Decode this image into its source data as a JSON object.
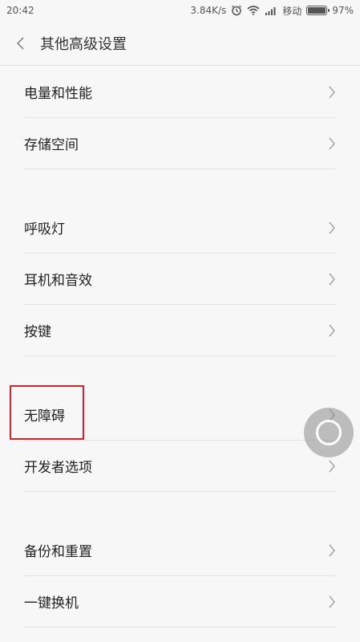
{
  "status_bar": {
    "time": "20:42",
    "speed": "3.84K/s",
    "carrier": "移动",
    "battery": "97%",
    "battery_level": 0.97,
    "icons": [
      "alarm-icon",
      "wifi-icon",
      "signal-icon",
      "battery-icon"
    ]
  },
  "header": {
    "title": "其他高级设置",
    "back_icon": "chevron-left-icon"
  },
  "groups": [
    {
      "items": [
        "电量和性能",
        "存储空间"
      ]
    },
    {
      "items": [
        "呼吸灯",
        "耳机和音效",
        "按键"
      ]
    },
    {
      "items": [
        "无障碍",
        "开发者选项"
      ]
    },
    {
      "items": [
        "备份和重置",
        "一键换机"
      ]
    }
  ],
  "highlight": {
    "item": "无障碍",
    "color": "#d9232d"
  },
  "floating_ball": {
    "icon": "quick-ball-icon"
  }
}
